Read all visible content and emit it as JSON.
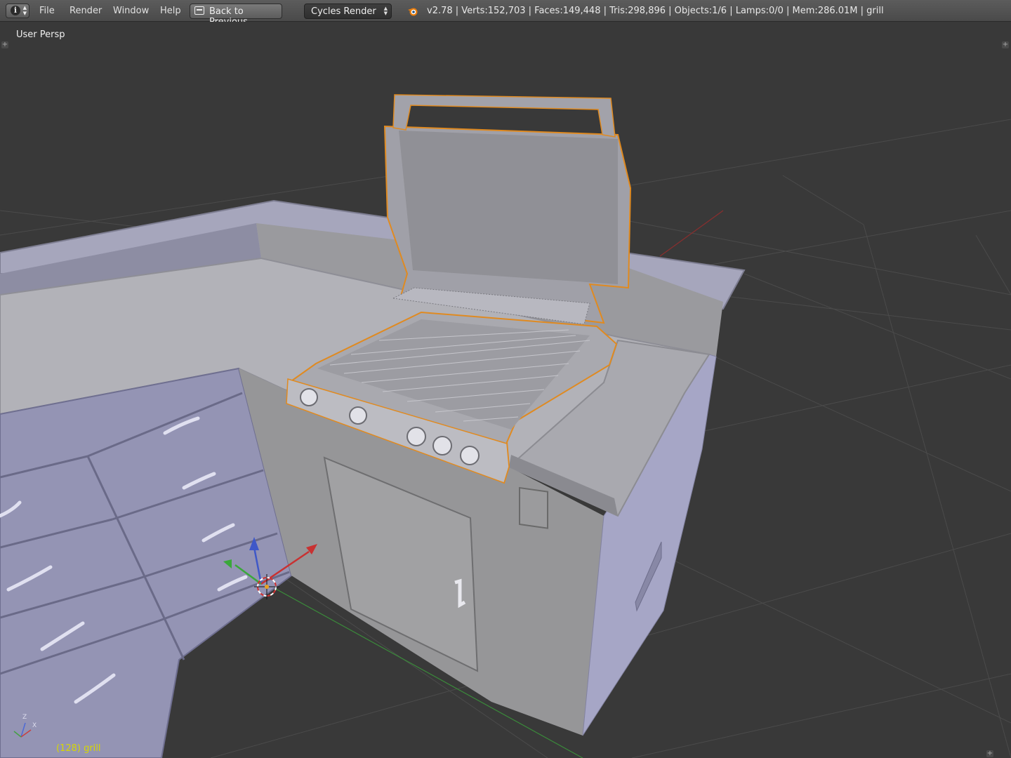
{
  "header": {
    "editor_type_icon": "info-icon",
    "menus": [
      "File",
      "Render",
      "Window",
      "Help"
    ],
    "back_button_label": "Back to Previous",
    "render_engine": "Cycles Render",
    "app_icon": "blender-logo-icon",
    "stats": "v2.78 | Verts:152,703 | Faces:149,448 | Tris:298,896 | Objects:1/6 | Lamps:0/0 | Mem:286.01M | grill"
  },
  "viewport": {
    "view_name": "User Persp",
    "active_object_label": "(128) grill",
    "axis_labels": {
      "z": "Z",
      "x": "X"
    }
  },
  "colors": {
    "background": "#393939",
    "grid": "#4a4a4a",
    "x_axis": "#b03030",
    "y_axis": "#3a9a3a",
    "selection_outline": "#e08a20",
    "object_label": "#d7d700"
  }
}
